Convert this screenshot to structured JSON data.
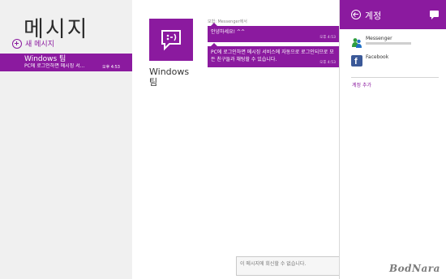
{
  "app": {
    "title": "메시지",
    "new_message": "새 메시지"
  },
  "conversation": {
    "name": "Windows 팀",
    "preview": "PC에 로그인하면 메시징 서...",
    "time": "오후 4:53"
  },
  "contact": {
    "name_line1": "Windows",
    "name_line2": "팀"
  },
  "thread": {
    "header": "모험: Messenger에서",
    "messages": [
      {
        "text": "안녕하세요! ^^",
        "time": "오후 4:53"
      },
      {
        "text": "PC에 로그인하면 메시징 서비스에 자동으로 로그인되므로 모든 친구들과 채팅할 수 있습니다.",
        "time": "오후 4:53"
      }
    ],
    "reply_placeholder": "이 메시지에 회신할 수 없습니다."
  },
  "accounts": {
    "title": "계정",
    "items": [
      {
        "name": "Messenger",
        "icon": "messenger-icon"
      },
      {
        "name": "Facebook",
        "icon": "facebook-icon"
      }
    ],
    "add_account": "계정 추가"
  },
  "colors": {
    "accent": "#8b1a9f",
    "left_pane": "#f0f0f0"
  },
  "watermark": "BodNara"
}
